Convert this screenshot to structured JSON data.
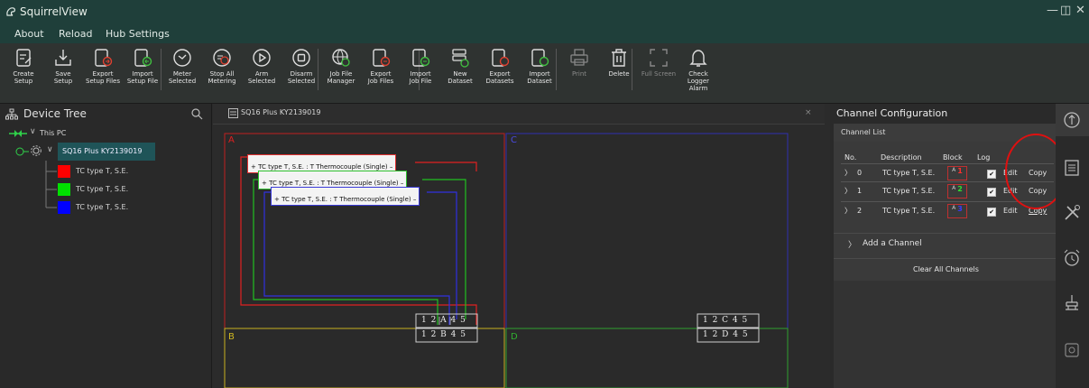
{
  "window": {
    "title": "SquirrelView",
    "minimize_glyph": "—",
    "maximize_glyph": "◫",
    "close_glyph": "✕"
  },
  "menu": {
    "items": [
      "About",
      "Reload",
      "Hub Settings"
    ]
  },
  "toolbar": {
    "buttons": [
      {
        "icon": "create-setup-icon",
        "label": "Create\nSetup"
      },
      {
        "icon": "save-setup-icon",
        "label": "Save\nSetup"
      },
      {
        "icon": "export-setup-files-icon",
        "label": "Export\nSetup Files"
      },
      {
        "icon": "import-setup-file-icon",
        "label": "Import\nSetup File"
      },
      {
        "icon": "meter-selected-icon",
        "label": "Meter\nSelected"
      },
      {
        "icon": "stop-all-metering-icon",
        "label": "Stop All\nMetering"
      },
      {
        "icon": "arm-selected-icon",
        "label": "Arm\nSelected"
      },
      {
        "icon": "disarm-selected-icon",
        "label": "Disarm\nSelected"
      },
      {
        "icon": "job-file-manager-icon",
        "label": "Job File\nManager"
      },
      {
        "icon": "export-job-files-icon",
        "label": "Export\nJob Files"
      },
      {
        "icon": "import-job-file-icon",
        "label": "Import\nJob File"
      },
      {
        "icon": "new-dataset-icon",
        "label": "New\nDataset"
      },
      {
        "icon": "export-datasets-icon",
        "label": "Export\nDatasets"
      },
      {
        "icon": "import-dataset-icon",
        "label": "Import\nDataset"
      },
      {
        "icon": "print-icon",
        "label": "Print"
      },
      {
        "icon": "delete-icon",
        "label": "Delete"
      },
      {
        "icon": "full-screen-icon",
        "label": "Full Screen"
      },
      {
        "icon": "check-logger-alarm-icon",
        "label": "Check\nLogger\nAlarm"
      }
    ]
  },
  "device_tree": {
    "title": "Device Tree",
    "pc_label": "This PC",
    "device_label": "SQ16 Plus KY2139019",
    "channels": [
      {
        "label": "TC type T, S.E.",
        "color": "#ff0000"
      },
      {
        "label": "TC type T, S.E.",
        "color": "#00e000"
      },
      {
        "label": "TC type T, S.E.",
        "color": "#0000ff"
      }
    ]
  },
  "center": {
    "tab_title": "SQ16 Plus KY2139019",
    "tab_close": "×",
    "blocks": {
      "a": "A",
      "b": "B",
      "c": "C",
      "d": "D"
    },
    "tc_labels": [
      {
        "text": "+ TC type T, S.E. : T Thermocouple (Single)  –",
        "color": "#e03030"
      },
      {
        "text": "+ TC type T, S.E. : T Thermocouple (Single)  –",
        "color": "#30c030"
      },
      {
        "text": "+ TC type T, S.E. : T Thermocouple (Single)  –",
        "color": "#3a3ad8"
      }
    ],
    "terminals": {
      "a": "1 2 A 4 5",
      "b": "1 2 B 4 5",
      "c": "1 2 C 4 5",
      "d": "1 2 D 4 5"
    }
  },
  "channel_config": {
    "title": "Channel Configuration",
    "list_title": "Channel List",
    "columns": {
      "no": "No.",
      "description": "Description",
      "block": "Block",
      "log": "Log"
    },
    "rows": [
      {
        "no": "0",
        "description": "TC type T, S.E.",
        "block_letter": "A",
        "block_num": "1",
        "num_color": "#ff3030",
        "log": "✔",
        "edit": "Edit",
        "copy": "Copy"
      },
      {
        "no": "1",
        "description": "TC type T, S.E.",
        "block_letter": "A",
        "block_num": "2",
        "num_color": "#30e030",
        "log": "✔",
        "edit": "Edit",
        "copy": "Copy"
      },
      {
        "no": "2",
        "description": "TC type T, S.E.",
        "block_letter": "A",
        "block_num": "3",
        "num_color": "#3a3aff",
        "log": "✔",
        "edit": "Edit",
        "copy": "Copy"
      }
    ],
    "add_channel": "Add a Channel",
    "clear_channels": "Clear All Channels"
  }
}
